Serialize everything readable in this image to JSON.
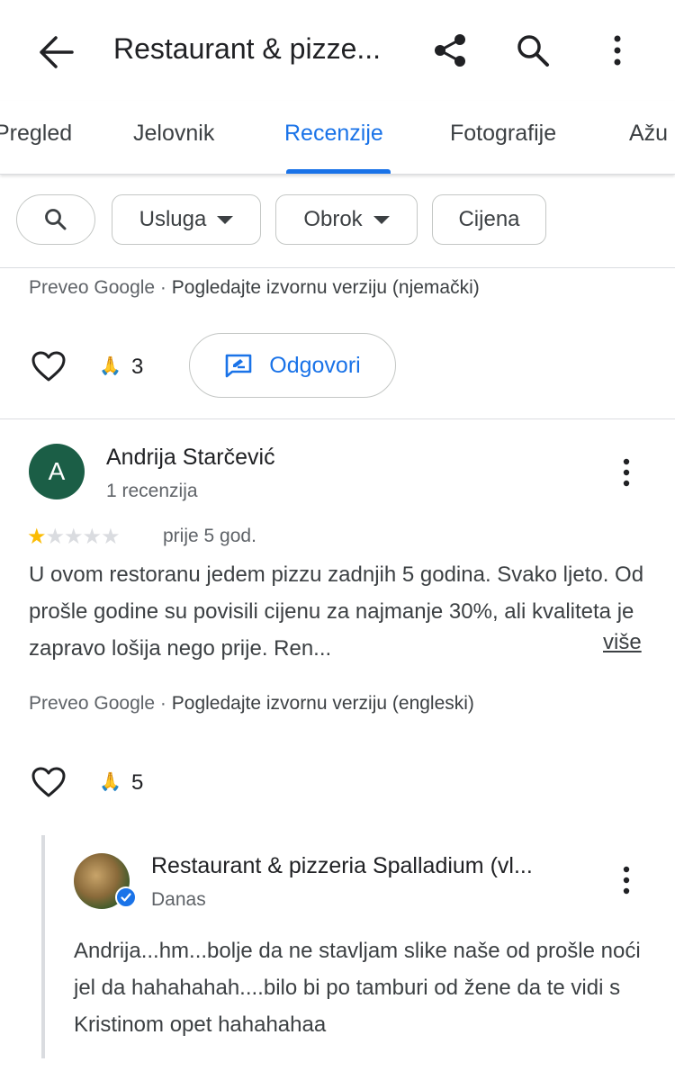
{
  "header": {
    "title": "Restaurant & pizze..."
  },
  "tabs": [
    {
      "label": "Pregled"
    },
    {
      "label": "Jelovnik"
    },
    {
      "label": "Recenzije"
    },
    {
      "label": "Fotografije"
    },
    {
      "label": "Ažu"
    }
  ],
  "filters": {
    "usluga": "Usluga",
    "obrok": "Obrok",
    "cijena": "Cijena"
  },
  "prev_review": {
    "translated_by": "Preveo Google",
    "view_original": "Pogledajte izvornu verziju (njemački)",
    "reaction_count": "3",
    "reply_label": "Odgovori"
  },
  "review": {
    "avatar_letter": "A",
    "author": "Andrija Starčević",
    "author_meta": "1 recenzija",
    "rating": 1,
    "rating_max": 5,
    "time_ago": "prije 5 god.",
    "text": "U ovom restoranu jedem pizzu zadnjih 5 godina. Svako ljeto. Od prošle godine su povisili cijenu za najmanje 30%, ali kvaliteta je zapravo lošija nego prije. Ren...",
    "more_label": "više",
    "translated_by": "Preveo Google",
    "view_original": "Pogledajte izvornu verziju (engleski)",
    "reaction_count": "5"
  },
  "owner_reply": {
    "name": "Restaurant & pizzeria Spalladium (vl...",
    "time": "Danas",
    "text": "Andrija...hm...bolje da ne stavljam slike naše od prošle noći jel da hahahahah....bilo bi po tamburi od žene da te vidi s Kristinom opet hahahahaa"
  },
  "colors": {
    "accent": "#1a73e8",
    "star": "#fbbc04",
    "avatar_a": "#1b5e46"
  }
}
